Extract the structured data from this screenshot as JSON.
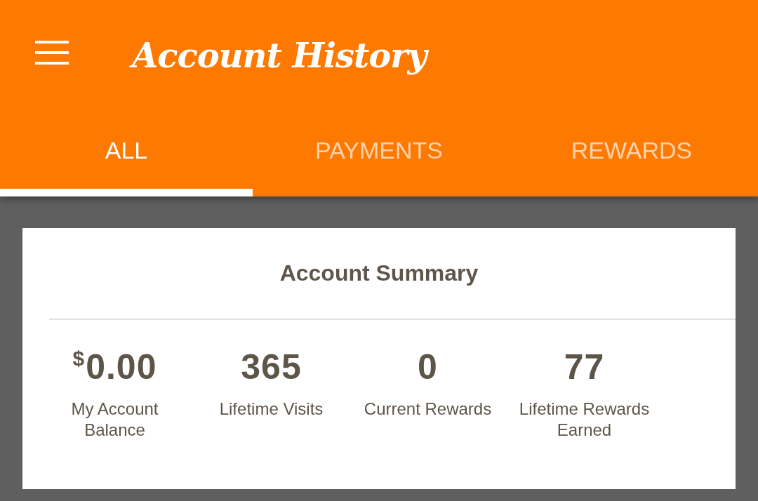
{
  "app_bar": {
    "title": "Account History"
  },
  "tabs": [
    {
      "label": "ALL",
      "selected": true
    },
    {
      "label": "PAYMENTS",
      "selected": false
    },
    {
      "label": "REWARDS",
      "selected": false
    }
  ],
  "summary": {
    "title": "Account Summary",
    "stats": [
      {
        "prefix": "$",
        "value": "0.00",
        "label": "My Account Balance"
      },
      {
        "value": "365",
        "label": "Lifetime Visits"
      },
      {
        "value": "0",
        "label": "Current Rewards"
      },
      {
        "value": "77",
        "label": "Lifetime Rewards Earned"
      }
    ]
  }
}
